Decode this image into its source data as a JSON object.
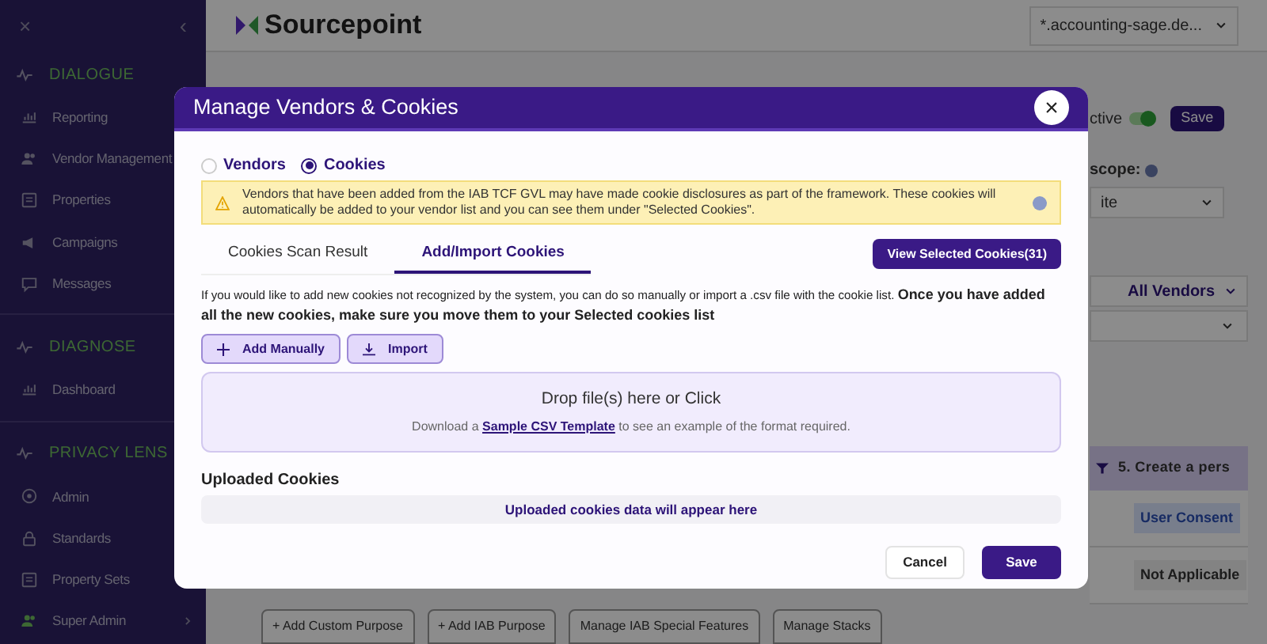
{
  "sidebar": {
    "close_glyph": "×",
    "collapse_glyph": "‹",
    "sections": [
      {
        "title": "DIALOGUE",
        "items": [
          {
            "label": "Reporting"
          },
          {
            "label": "Vendor Management"
          },
          {
            "label": "Properties"
          },
          {
            "label": "Campaigns"
          },
          {
            "label": "Messages"
          }
        ]
      },
      {
        "title": "DIAGNOSE",
        "items": [
          {
            "label": "Dashboard"
          }
        ]
      },
      {
        "title": "PRIVACY LENS",
        "items": [
          {
            "label": "Admin"
          },
          {
            "label": "Standards"
          },
          {
            "label": "Property Sets"
          },
          {
            "label": "Super Admin",
            "expandable": true
          }
        ]
      }
    ]
  },
  "header": {
    "logo": "Sourcepoint",
    "domain": "*.accounting-sage.de..."
  },
  "background": {
    "status_label": "ctive",
    "toggle_on": true,
    "save": "Save",
    "scope_label": "scope:",
    "scope_value": "ite",
    "vendor_filter": "All Vendors",
    "table_header": "5. Create a pers",
    "cells": [
      {
        "text": "User Consent",
        "kind": "badge"
      },
      {
        "text": "Not Applicable",
        "kind": "plain"
      }
    ],
    "buttons": [
      "+ Add Custom Purpose",
      "+ Add IAB Purpose",
      "Manage IAB Special Features",
      "Manage Stacks"
    ]
  },
  "modal": {
    "title": "Manage Vendors & Cookies",
    "close": "×",
    "modes": [
      {
        "label": "Vendors",
        "selected": false
      },
      {
        "label": "Cookies",
        "selected": true
      }
    ],
    "alert": "Vendors that have been added from the IAB TCF GVL may have made cookie disclosures as part of the framework. These cookies will automatically be added to your vendor list and you can see them under \"Selected Cookies\".",
    "tabs": [
      {
        "label": "Cookies Scan Result",
        "selected": false
      },
      {
        "label": "Add/Import Cookies",
        "selected": true
      }
    ],
    "view_selected": "View Selected Cookies(31)",
    "description": "If you would like to add new cookies not recognized by the system, you can do so manually or import a .csv file with the cookie list. **Once you have added all the new cookies, make sure you move them to your Selected cookies list**",
    "actions": [
      {
        "label": "Add Manually",
        "kind": "add"
      },
      {
        "label": "Import",
        "kind": "import"
      }
    ],
    "dropzone": {
      "title": "Drop file(s) here or Click",
      "hint_before": "Download a",
      "link": "Sample CSV Template",
      "hint_after": "to see an example of the format required."
    },
    "uploaded_title": "Uploaded Cookies",
    "uploaded_empty": "Uploaded cookies data will appear here",
    "cancel": "Cancel",
    "save": "Save"
  }
}
